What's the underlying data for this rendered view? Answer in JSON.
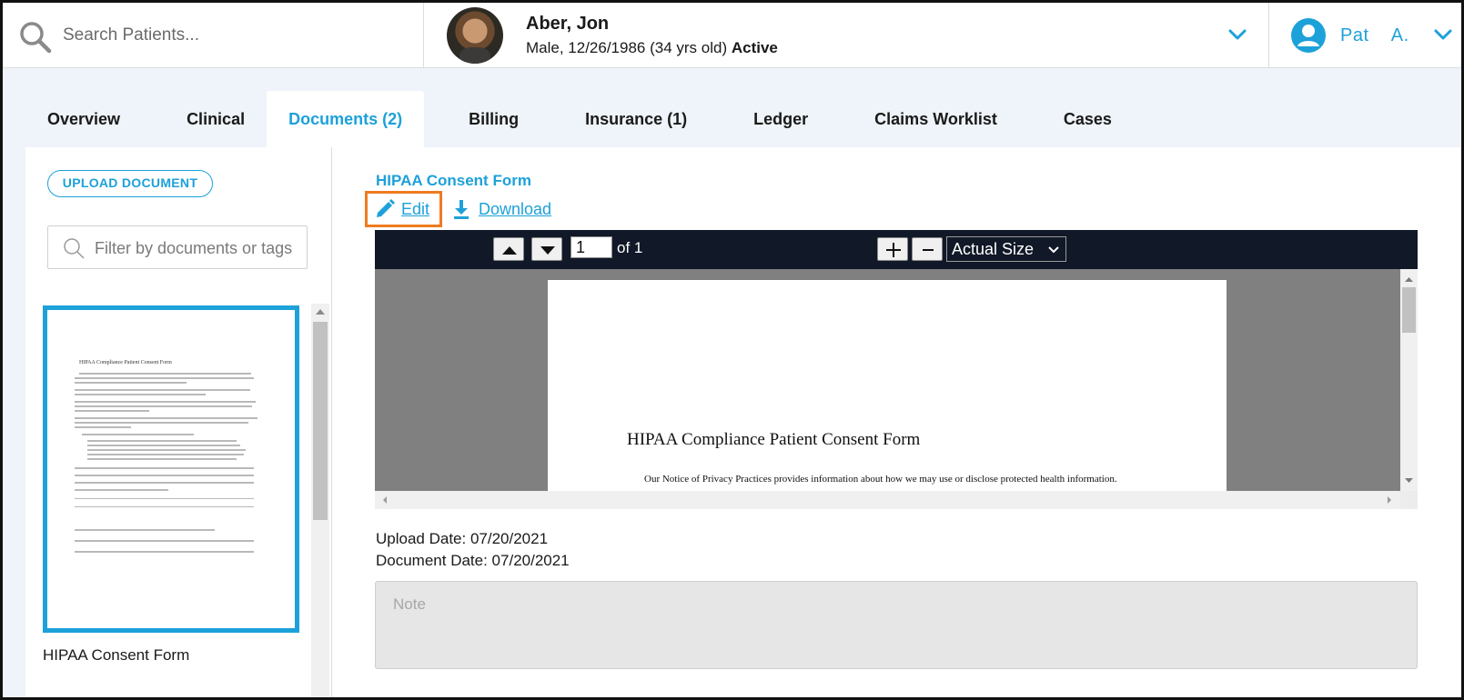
{
  "header": {
    "search_placeholder": "Search Patients...",
    "patient": {
      "name": "Aber, Jon",
      "info": "Male, 12/26/1986 (34 yrs old)",
      "status": "Active"
    },
    "user": {
      "first": "Pat",
      "last": "A."
    }
  },
  "tabs": [
    {
      "label": "Overview"
    },
    {
      "label": "Clinical"
    },
    {
      "label": "Documents (2)",
      "active": true
    },
    {
      "label": "Billing"
    },
    {
      "label": "Insurance (1)"
    },
    {
      "label": "Ledger"
    },
    {
      "label": "Claims Worklist"
    },
    {
      "label": "Cases"
    }
  ],
  "sidebar": {
    "upload_label": "UPLOAD DOCUMENT",
    "filter_placeholder": "Filter by documents or tags",
    "thumbnail_title": "HIPAA Compliance Patient Consent Form",
    "document_caption": "HIPAA Consent Form"
  },
  "document": {
    "title": "HIPAA Consent Form",
    "edit_label": "Edit",
    "download_label": "Download",
    "upload_date": "Upload Date: 07/20/2021",
    "document_date": "Document Date: 07/20/2021",
    "note_placeholder": "Note"
  },
  "viewer": {
    "page_value": "1",
    "page_total": "of 1",
    "zoom": "Actual Size",
    "page_heading": "HIPAA Compliance Patient Consent Form",
    "page_text": "Our Notice of Privacy Practices provides information about how we may use or disclose protected health information."
  },
  "colors": {
    "accent": "#1da1d9",
    "highlight": "#f07b1f",
    "toolbar": "#111827"
  }
}
